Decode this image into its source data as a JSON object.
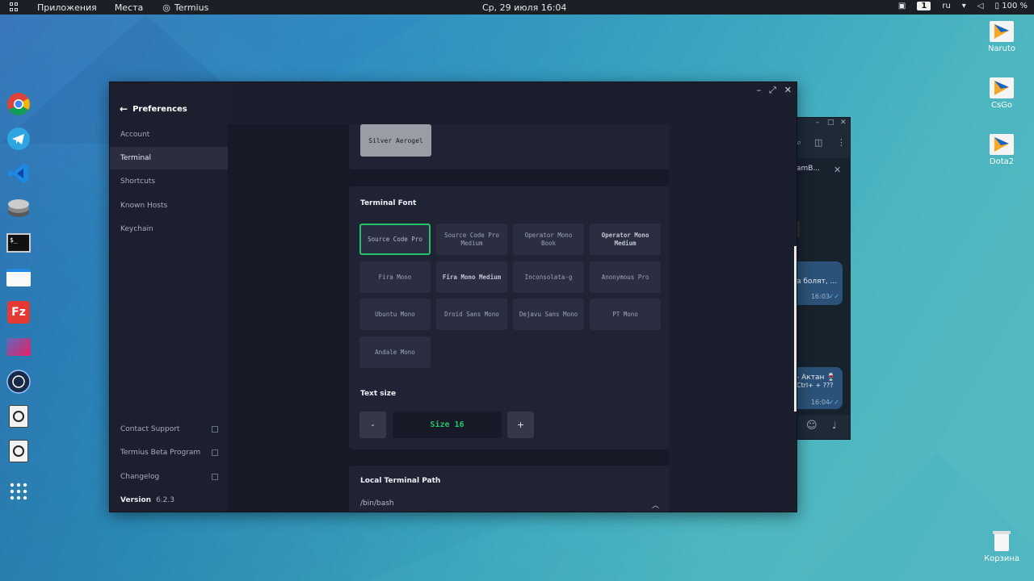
{
  "topbar": {
    "apps_menu": "Приложения",
    "places_menu": "Места",
    "active_app": "Termius",
    "clock": "Ср, 29 июля  16:04",
    "workspace": "1",
    "keyboard_layout": "ru",
    "battery": "100 %"
  },
  "desktop_icons": [
    {
      "label": "Naruto"
    },
    {
      "label": "CsGo"
    },
    {
      "label": "Dota2"
    },
    {
      "label": "Корзина"
    }
  ],
  "dock": [
    "chrome-icon",
    "telegram-icon",
    "vscode-icon",
    "disks-icon",
    "terminal-icon",
    "files-icon",
    "filezilla-icon",
    "screenshot-icon",
    "browser-icon",
    "disk-icon",
    "disk-icon",
    "app-grid-icon"
  ],
  "telegram_bg": {
    "chat_name_fragment": "amB...",
    "msg1_text": "а болят, ...",
    "msg1_time": "16:03",
    "msg2_text": "- Актан 🍷",
    "msg2_sub": "Ctrl+ + ???",
    "msg2_time": "16:04"
  },
  "window": {
    "controls": {
      "minimize": "–",
      "maximize": "⤢",
      "close": "✕"
    },
    "back_label": "Preferences",
    "nav": [
      {
        "label": "Account",
        "active": false
      },
      {
        "label": "Terminal",
        "active": true
      },
      {
        "label": "Shortcuts",
        "active": false
      },
      {
        "label": "Known Hosts",
        "active": false
      },
      {
        "label": "Keychain",
        "active": false
      }
    ],
    "bottom_links": [
      {
        "label": "Contact Support"
      },
      {
        "label": "Termius Beta Program"
      },
      {
        "label": "Changelog"
      }
    ],
    "version_label": "Version",
    "version_value": "6.2.3"
  },
  "theme": {
    "selected": "Silver Aerogel"
  },
  "terminal_font": {
    "title": "Terminal Font",
    "fonts": [
      {
        "label": "Source Code Pro",
        "selected": true
      },
      {
        "label": "Source Code Pro Medium",
        "selected": false
      },
      {
        "label": "Operator Mono Book",
        "selected": false
      },
      {
        "label": "Operator Mono Medium",
        "selected": false
      },
      {
        "label": "Fira Mono",
        "selected": false
      },
      {
        "label": "Fira Mono Medium",
        "selected": false
      },
      {
        "label": "Inconsolata-g",
        "selected": false
      },
      {
        "label": "Anonymous Pro",
        "selected": false
      },
      {
        "label": "Ubuntu Mono",
        "selected": false
      },
      {
        "label": "Droid Sans Mono",
        "selected": false
      },
      {
        "label": "Dejavu Sans Mono",
        "selected": false
      },
      {
        "label": "PT Mono",
        "selected": false
      },
      {
        "label": "Andale Mono",
        "selected": false
      }
    ]
  },
  "text_size": {
    "title": "Text size",
    "decrease": "-",
    "value": "Size 16",
    "increase": "+"
  },
  "local_path": {
    "title": "Local Terminal Path",
    "value": "/bin/bash"
  },
  "colors": {
    "accent": "#22c46b",
    "sidebar_bg": "#1c1f2e",
    "card_bg": "#1f2333"
  }
}
